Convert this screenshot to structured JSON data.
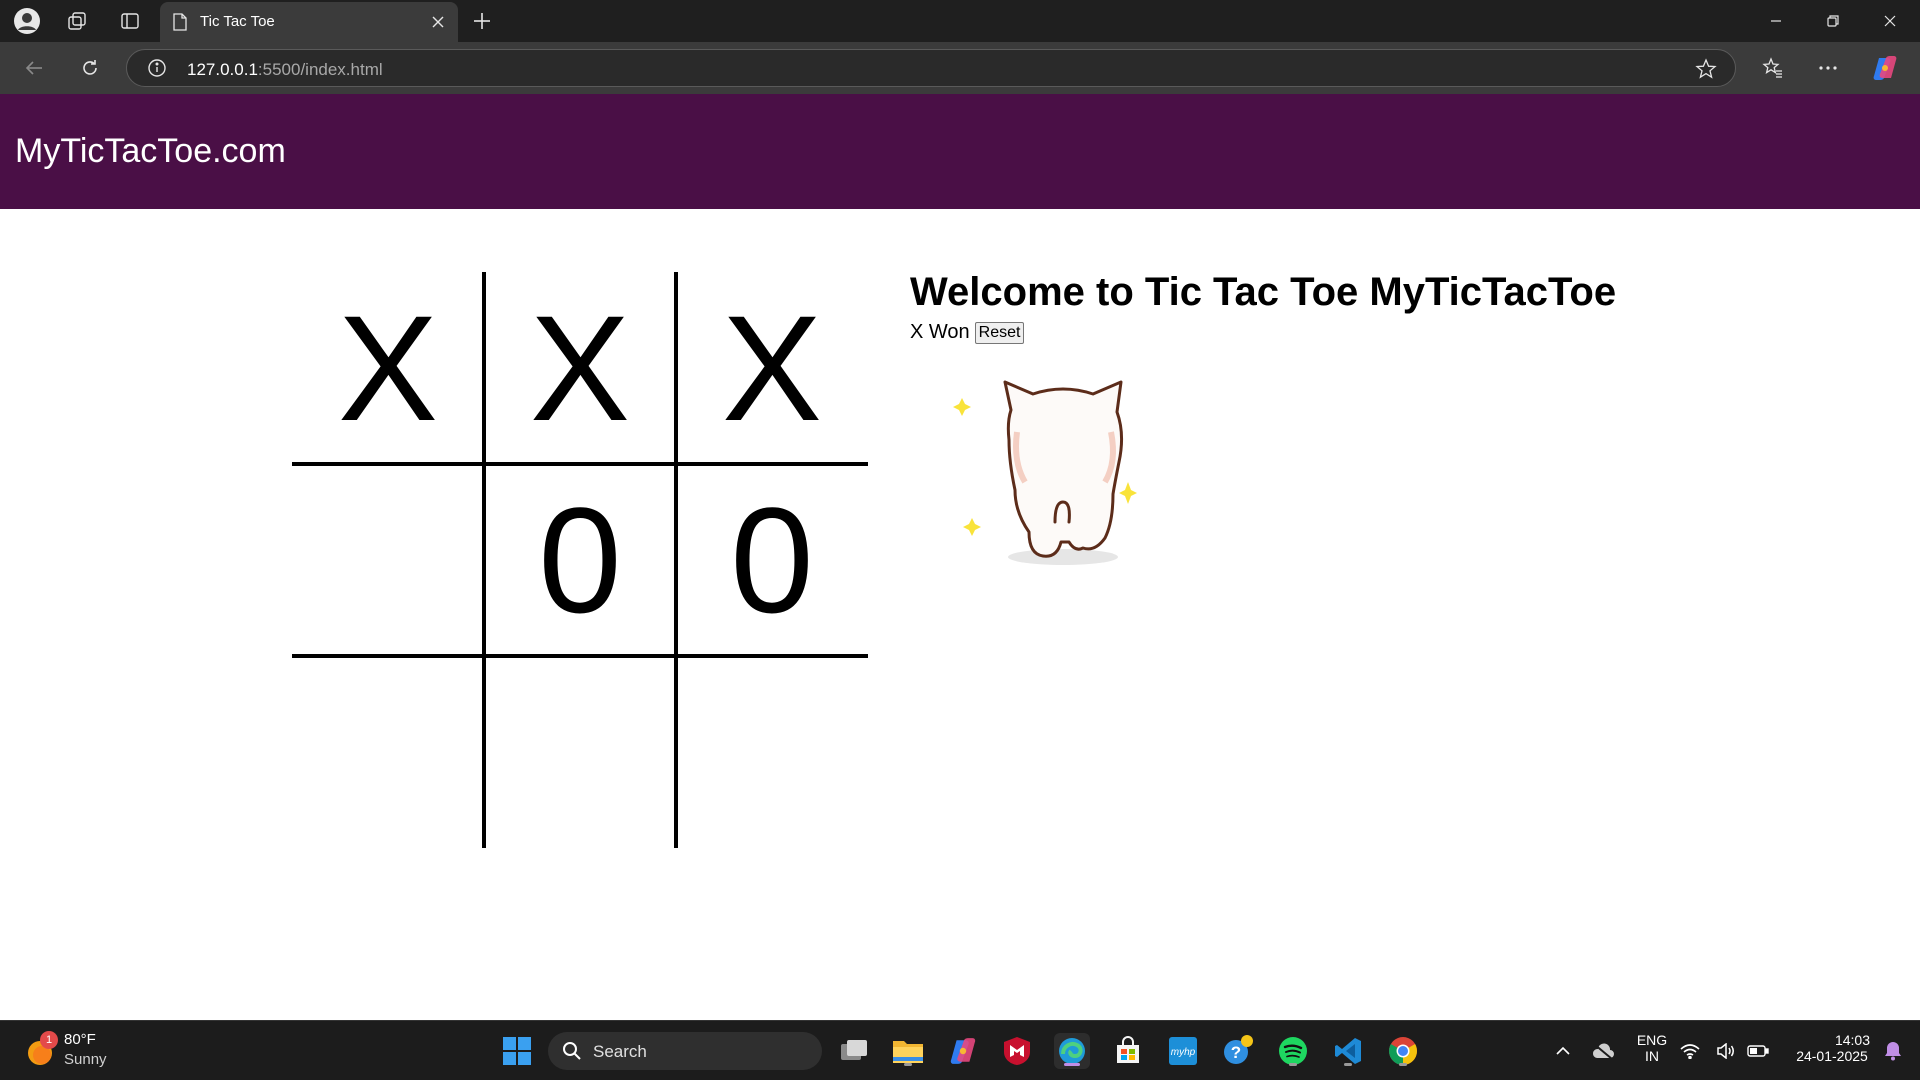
{
  "browser": {
    "tab_title": "Tic Tac Toe",
    "url_host": "127.0.0.1",
    "url_path": ":5500/index.html"
  },
  "header": {
    "site_title": "MyTicTacToe.com"
  },
  "board": {
    "cells": [
      "X",
      "X",
      "X",
      "",
      "0",
      "0",
      "",
      "",
      ""
    ]
  },
  "info": {
    "welcome": "Welcome to Tic Tac Toe MyTicTacToe",
    "status": "X Won",
    "reset_label": "Reset"
  },
  "taskbar": {
    "weather_temp": "80°F",
    "weather_desc": "Sunny",
    "weather_badge": "1",
    "search_label": "Search",
    "lang_line1": "ENG",
    "lang_line2": "IN",
    "time": "14:03",
    "date": "24-01-2025"
  },
  "colors": {
    "header_bg": "#4a0f46",
    "chrome_dark": "#1f1f1f",
    "chrome_tab": "#3b3b3b"
  }
}
